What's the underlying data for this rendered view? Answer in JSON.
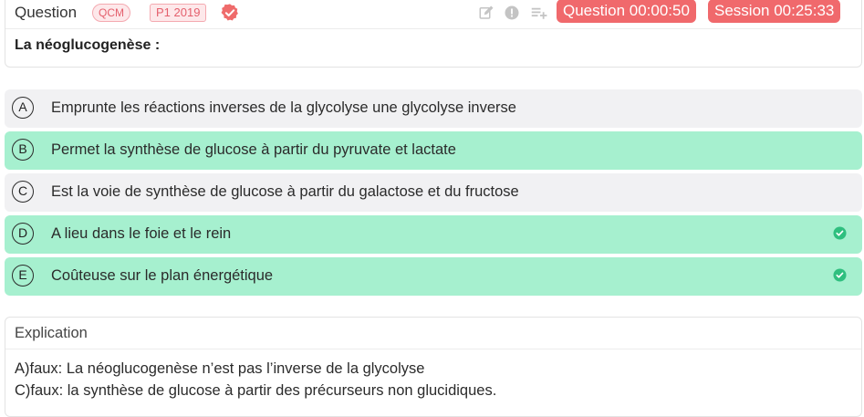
{
  "header": {
    "title": "Question",
    "badge_type": "QCM",
    "badge_year": "P1 2019",
    "verified_icon": "verified-badge-icon",
    "tools": [
      "edit-icon",
      "alert-circle-icon",
      "playlist-add-icon"
    ],
    "timer_question": "Question 00:00:50",
    "timer_session": "Session 00:25:33"
  },
  "question": {
    "text": "La néoglucogenèse :"
  },
  "options": [
    {
      "letter": "A",
      "text": "Emprunte les réactions inverses de la glycolyse une glycolyse inverse",
      "correct": false,
      "checked": false
    },
    {
      "letter": "B",
      "text": "Permet la synthèse de glucose à partir du pyruvate et lactate",
      "correct": true,
      "checked": false
    },
    {
      "letter": "C",
      "text": "Est la voie de synthèse de glucose à partir du galactose et du fructose",
      "correct": false,
      "checked": false
    },
    {
      "letter": "D",
      "text": "A lieu dans le foie et le rein",
      "correct": true,
      "checked": true
    },
    {
      "letter": "E",
      "text": "Coûteuse sur le plan énergétique",
      "correct": true,
      "checked": true
    }
  ],
  "explanation": {
    "title": "Explication",
    "lines": [
      "A)faux: La néoglucogenèse n’est pas l’inverse de la glycolyse",
      "C)faux: la synthèse de glucose à partir des précurseurs non glucidiques."
    ]
  },
  "colors": {
    "correct_bg": "#a6f0cf",
    "neutral_bg": "#f1f1f3",
    "timer_bg": "#f0696c",
    "badge_text": "#e4606d",
    "check": "#2fbf7f"
  }
}
